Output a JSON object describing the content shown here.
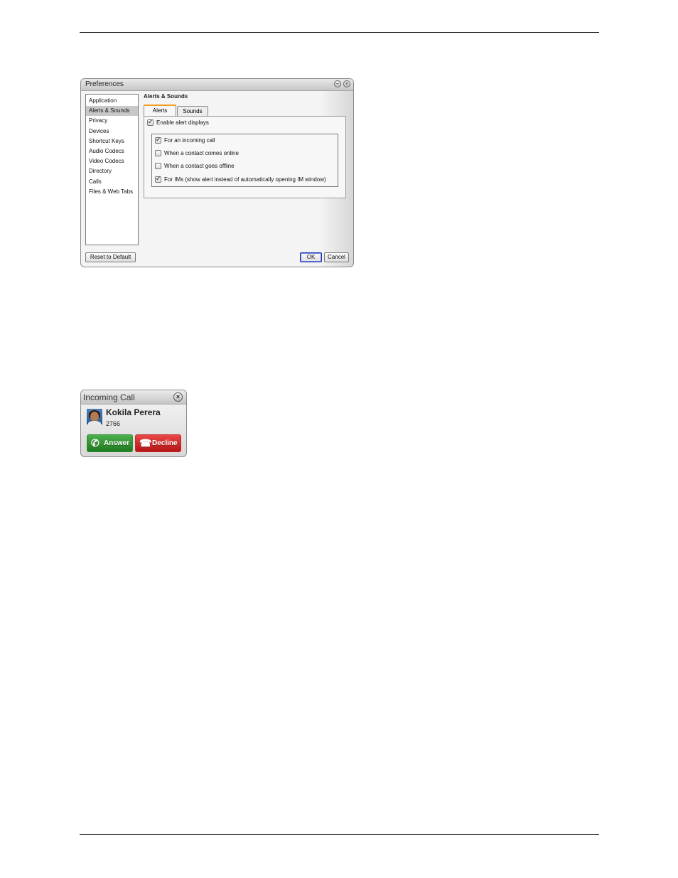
{
  "preferences": {
    "title": "Preferences",
    "window_buttons": {
      "minimize": "–",
      "close": "×"
    },
    "sidebar": {
      "items": [
        {
          "label": "Application",
          "selected": false
        },
        {
          "label": "Alerts & Sounds",
          "selected": true
        },
        {
          "label": "Privacy",
          "selected": false
        },
        {
          "label": "Devices",
          "selected": false
        },
        {
          "label": "Shortcut Keys",
          "selected": false
        },
        {
          "label": "Audio Codecs",
          "selected": false
        },
        {
          "label": "Video Codecs",
          "selected": false
        },
        {
          "label": "Directory",
          "selected": false
        },
        {
          "label": "Calls",
          "selected": false
        },
        {
          "label": "Files & Web Tabs",
          "selected": false
        }
      ]
    },
    "section_title": "Alerts & Sounds",
    "tabs": [
      {
        "label": "Alerts",
        "active": true
      },
      {
        "label": "Sounds",
        "active": false
      }
    ],
    "enable_alerts": {
      "label": "Enable alert displays",
      "checked": true
    },
    "alert_options": [
      {
        "label": "For an incoming call",
        "checked": true
      },
      {
        "label": "When a contact comes online",
        "checked": false
      },
      {
        "label": "When a contact goes offline",
        "checked": false
      },
      {
        "label": "For IMs (show alert instead of automatically opening IM window)",
        "checked": true
      }
    ],
    "buttons": {
      "reset": "Reset to Default",
      "ok": "OK",
      "cancel": "Cancel"
    },
    "accent_color": "#f0a020"
  },
  "incoming_call": {
    "title": "Incoming Call",
    "close_icon": "×",
    "caller_name": "Kokila Perera",
    "caller_number": "2766",
    "answer_label": "Answer",
    "decline_label": "Decline",
    "answer_color": "#2f8f2f",
    "decline_color": "#c22a2a"
  }
}
